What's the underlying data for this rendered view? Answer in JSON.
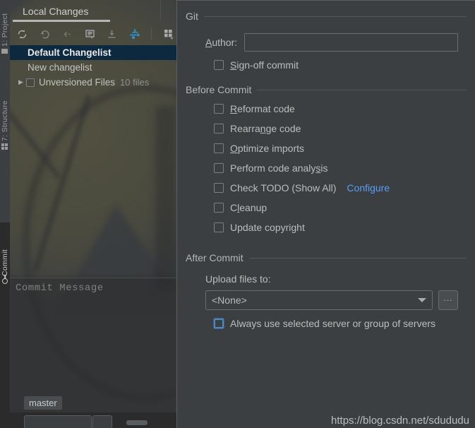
{
  "rail": {
    "items": [
      {
        "label": "1: Project",
        "icon": "folder-icon"
      },
      {
        "label": "7: Structure",
        "icon": "grid-icon"
      },
      {
        "label": "Commit",
        "icon": "commit-icon"
      }
    ]
  },
  "left_panel": {
    "tab": {
      "label": "Local Changes"
    },
    "toolbar": {
      "buttons": [
        {
          "name": "refresh-icon",
          "tooltip": "Refresh"
        },
        {
          "name": "rollback-icon",
          "tooltip": "Rollback"
        },
        {
          "name": "shelve-icon",
          "tooltip": "Shelve Silently"
        },
        {
          "name": "show-diff-icon",
          "tooltip": "Show Diff"
        },
        {
          "name": "get-from-vcs-icon",
          "tooltip": "Update"
        },
        {
          "name": "resolve-conflicts-icon",
          "tooltip": "Resolve Conflicts"
        },
        {
          "name": "group-by-icon",
          "tooltip": "Group By"
        }
      ]
    },
    "tree": [
      {
        "label": "Default Changelist",
        "selected": true,
        "checkbox": false,
        "twisty": "",
        "count": ""
      },
      {
        "label": "New changelist",
        "selected": false,
        "checkbox": false,
        "twisty": "",
        "count": ""
      },
      {
        "label": "Unversioned Files",
        "selected": false,
        "checkbox": true,
        "twisty": "▶",
        "count": "10 files"
      }
    ],
    "commit_message": {
      "placeholder": "Commit Message",
      "value": ""
    },
    "branch": {
      "label": "master"
    }
  },
  "dialog": {
    "sections": [
      {
        "title": "Git",
        "author": {
          "label": "Author:",
          "mnemonic": "A",
          "value": "",
          "placeholder": ""
        },
        "signoff": {
          "label": "Sign-off commit",
          "mnemonic": "S",
          "checked": false
        }
      },
      {
        "title": "Before Commit",
        "options": [
          {
            "label": "Reformat code",
            "mnemonic": "R",
            "checked": false
          },
          {
            "label": "Rearrange code",
            "mnemonic": "n",
            "checked": false
          },
          {
            "label": "Optimize imports",
            "mnemonic": "O",
            "checked": false
          },
          {
            "label": "Perform code analysis",
            "mnemonic": "s",
            "checked": false
          },
          {
            "label": "Check TODO (Show All)",
            "mnemonic": "",
            "checked": false,
            "link": "Configure"
          },
          {
            "label": "Cleanup",
            "mnemonic": "l",
            "checked": false
          },
          {
            "label": "Update copyright",
            "mnemonic": "",
            "checked": false
          }
        ]
      },
      {
        "title": "After Commit",
        "upload_label": "Upload files to:",
        "upload_value": "<None>",
        "browse_label": "...",
        "always_use": {
          "label": "Always use selected server or group of servers",
          "checked": false,
          "focused": true
        }
      }
    ]
  },
  "watermark": {
    "text": "https://blog.csdn.net/sdududu"
  },
  "colors": {
    "panel_bg": "#3c3f41",
    "window_bg": "#2b2b2b",
    "selection_bg": "#0d293f",
    "link": "#589df6",
    "accent_blue": "#4a88c7",
    "text": "#bcbcbc"
  }
}
